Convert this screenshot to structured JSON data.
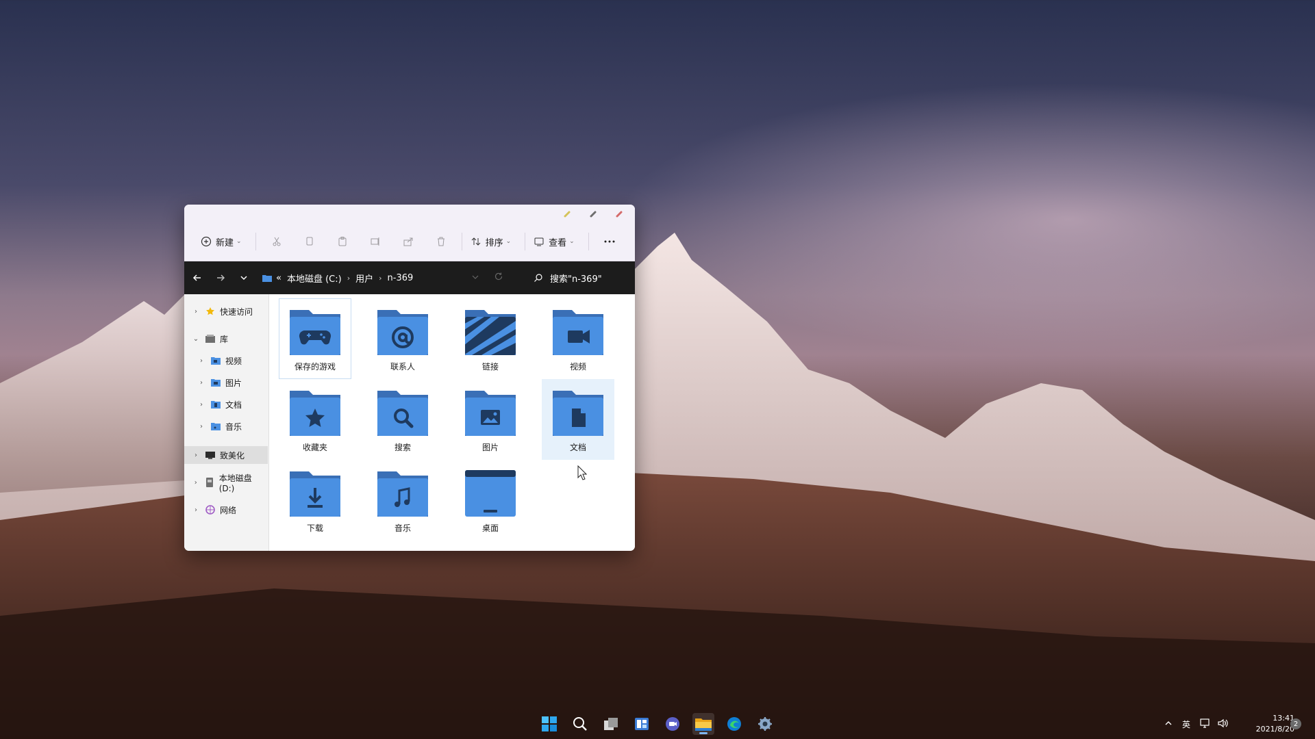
{
  "window": {
    "toolbar": {
      "new_label": "新建",
      "sort_label": "排序",
      "view_label": "查看"
    },
    "address": {
      "overflow": "«",
      "crumbs": [
        "本地磁盘 (C:)",
        "用户",
        "n-369"
      ],
      "search_placeholder": "搜索\"n-369\""
    },
    "sidebar": {
      "items": [
        {
          "label": "快速访问",
          "icon": "star-icon"
        },
        {
          "label": "库",
          "icon": "library-icon"
        },
        {
          "label": "视频",
          "icon": "video-folder-icon"
        },
        {
          "label": "图片",
          "icon": "pictures-folder-icon"
        },
        {
          "label": "文档",
          "icon": "documents-folder-icon"
        },
        {
          "label": "音乐",
          "icon": "music-folder-icon"
        },
        {
          "label": "致美化",
          "icon": "monitor-icon"
        },
        {
          "label": "本地磁盘 (D:)",
          "icon": "drive-icon"
        },
        {
          "label": "网络",
          "icon": "network-icon"
        }
      ]
    },
    "folders": [
      {
        "label": "保存的游戏",
        "icon": "gamepad-icon"
      },
      {
        "label": "联系人",
        "icon": "at-sign-icon"
      },
      {
        "label": "链接",
        "icon": "striped-link-icon"
      },
      {
        "label": "视频",
        "icon": "video-camera-icon"
      },
      {
        "label": "收藏夹",
        "icon": "star-icon"
      },
      {
        "label": "搜索",
        "icon": "magnifier-icon"
      },
      {
        "label": "图片",
        "icon": "image-icon"
      },
      {
        "label": "文档",
        "icon": "document-icon"
      },
      {
        "label": "下载",
        "icon": "download-arrow-icon"
      },
      {
        "label": "音乐",
        "icon": "music-note-icon"
      },
      {
        "label": "桌面",
        "icon": "desktop-icon"
      }
    ]
  },
  "taskbar": {
    "tray": {
      "ime": "英",
      "time": "13:41",
      "date": "2021/8/20",
      "notifications": "2"
    }
  },
  "colors": {
    "folder_blue": "#4a90e2",
    "folder_dark": "#1e3a5f",
    "address_bar": "#1c1c1c",
    "toolbar_bg": "#f3f0f8"
  }
}
